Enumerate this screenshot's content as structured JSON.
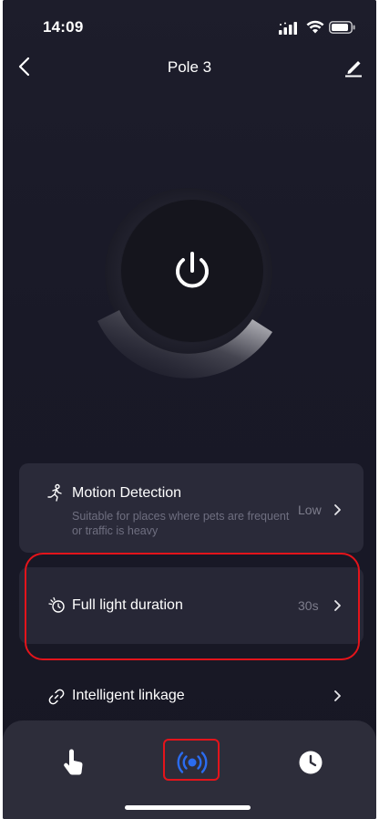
{
  "status_bar": {
    "time": "14:09"
  },
  "header": {
    "title": "Pole 3"
  },
  "settings": {
    "motion_detection": {
      "title": "Motion Detection",
      "description": "Suitable for places where pets are frequent or traffic is heavy",
      "value": "Low"
    },
    "full_light_duration": {
      "title": "Full light duration",
      "value": "30s"
    },
    "intelligent_linkage": {
      "title": "Intelligent linkage"
    }
  },
  "tabs": [
    {
      "icon": "hand-tap-icon",
      "active": false
    },
    {
      "icon": "radar-signal-icon",
      "active": true
    },
    {
      "icon": "clock-icon",
      "active": false
    }
  ],
  "colors": {
    "background": "#1b1b28",
    "card": "#2a2a39",
    "accent_active": "#2b6cf0",
    "highlight": "#e3141b"
  }
}
